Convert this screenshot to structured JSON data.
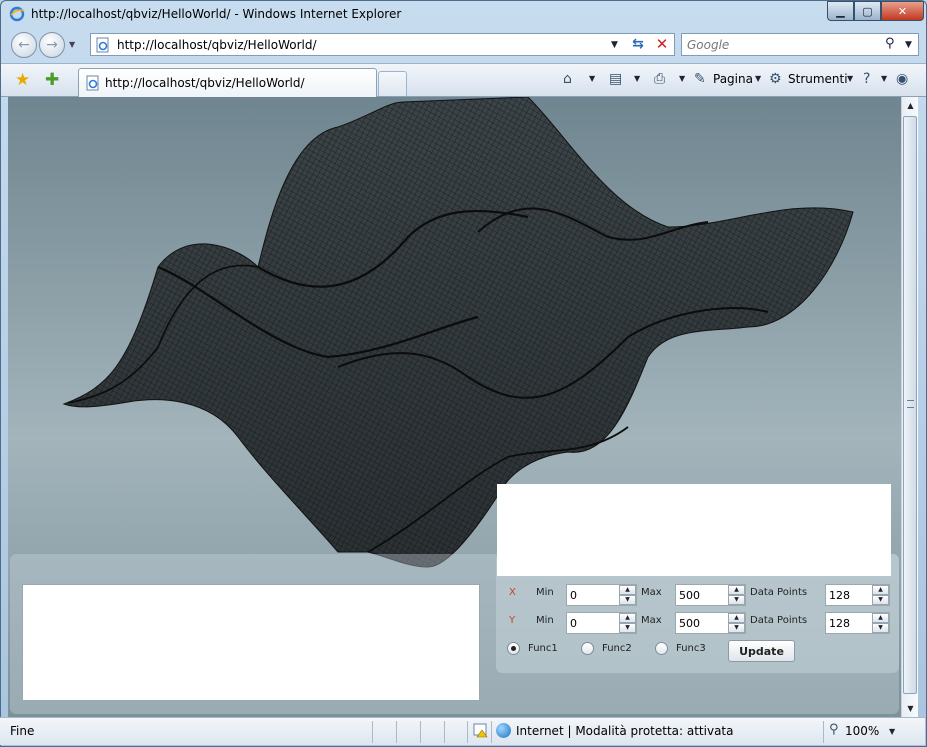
{
  "window": {
    "title": "http://localhost/qbviz/HelloWorld/ - Windows Internet Explorer"
  },
  "address_bar": {
    "url": "http://localhost/qbviz/HelloWorld/",
    "search_placeholder": "Google"
  },
  "tab": {
    "label": "http://localhost/qbviz/HelloWorld/"
  },
  "toolbar": {
    "page_label": "Pagina",
    "tools_label": "Strumenti"
  },
  "controls": {
    "x_label": "X",
    "y_label": "Y",
    "min_label": "Min",
    "max_label": "Max",
    "points_label": "Data Points",
    "x_min": "0",
    "x_max": "500",
    "x_points": "128",
    "y_min": "0",
    "y_max": "500",
    "y_points": "128",
    "func1": "Func1",
    "func2": "Func2",
    "func3": "Func3",
    "selected_func": "Func1",
    "update_label": "Update"
  },
  "status": {
    "text": "Fine",
    "zone": "Internet | Modalità protetta: attivata",
    "zoom": "100%"
  },
  "colors": {
    "accent_axis": "#d23a2a",
    "content_bg": "#8fa3ab",
    "mesh_stroke": "#111111"
  }
}
